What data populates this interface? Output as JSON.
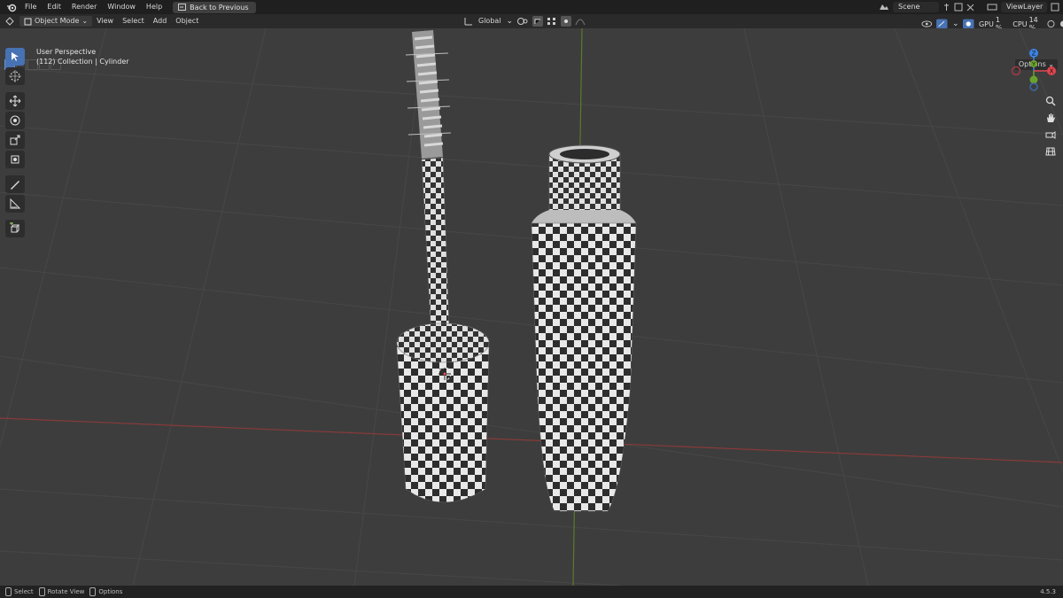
{
  "menu": {
    "items": [
      "File",
      "Edit",
      "Render",
      "Window",
      "Help"
    ],
    "back_button": "Back to Previous",
    "scene": "Scene",
    "view_layer": "ViewLayer"
  },
  "header": {
    "mode": "Object Mode",
    "items": [
      "View",
      "Select",
      "Add",
      "Object"
    ],
    "transform_orientation": "Global",
    "gpu_label": "GPU",
    "gpu_value": "1 %",
    "cpu_label": "CPU",
    "cpu_value": "14 %"
  },
  "viewport": {
    "perspective": "User Perspective",
    "collection": "(112) Collection | Cylinder",
    "options": "Options",
    "gizmo": {
      "x": "X",
      "y": "Y",
      "z": "Z"
    }
  },
  "status": {
    "select": "Select",
    "rotate": "Rotate View",
    "options": "Options",
    "version": "4.5.3"
  },
  "colors": {
    "accent": "#4772b3",
    "x_axis": "#e0454f",
    "y_axis": "#6aa32b",
    "z_axis": "#3d84e6"
  },
  "icons": {
    "tools": [
      "select-box-icon",
      "cursor-icon",
      "move-icon",
      "rotate-icon",
      "scale-icon",
      "transform-icon",
      "annotate-icon",
      "measure-icon",
      "add-cube-icon"
    ],
    "nav": [
      "zoom-icon",
      "hand-icon",
      "camera-icon",
      "grid-icon"
    ]
  }
}
